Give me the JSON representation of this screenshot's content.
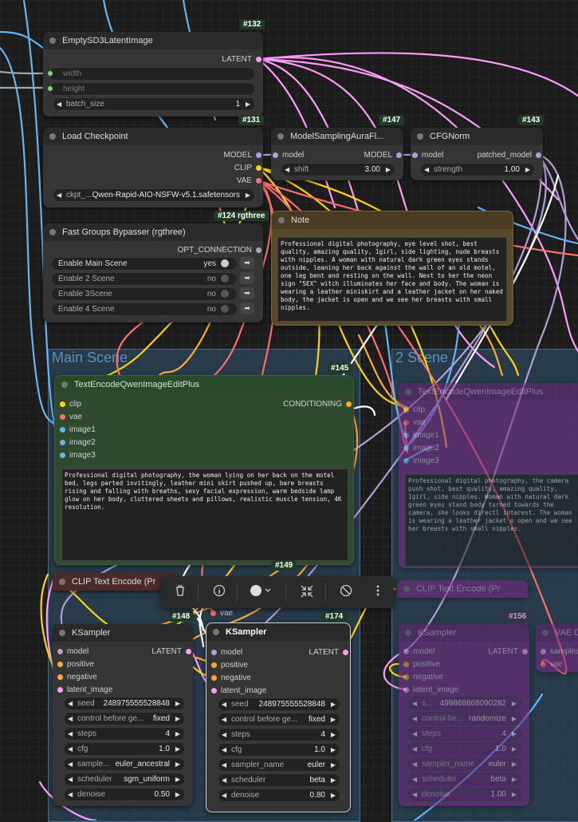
{
  "colors": {
    "latent": "#ff9cf9",
    "model": "#b39ddb",
    "clip": "#ffd500",
    "vae": "#ff6e6e",
    "image": "#64b5f6",
    "conditioning": "#ffa931",
    "white": "#ffffff"
  },
  "groups": {
    "main": "Main Scene",
    "scene2": "2 Scene"
  },
  "nodes": {
    "n132": {
      "badge": "#132",
      "title": "EmptySD3LatentImage",
      "out_latent": "LATENT",
      "w_width": "width",
      "w_height": "height",
      "w_batch_label": "batch_size",
      "w_batch_value": "1"
    },
    "n131": {
      "badge": "#131",
      "title": "Load Checkpoint",
      "out_model": "MODEL",
      "out_clip": "CLIP",
      "out_vae": "VAE",
      "w_ckpt_label": "ckpt_...",
      "w_ckpt_value": "Qwen-Rapid-AIO-NSFW-v5.1.safetensors"
    },
    "n147": {
      "badge": "#147",
      "title": "ModelSamplingAuraFl...",
      "in_model": "model",
      "out_model": "MODEL",
      "w_label": "shift",
      "w_value": "3.00"
    },
    "n143": {
      "badge": "#143",
      "title": "CFGNorm",
      "in_model": "model",
      "out_model": "patched_model",
      "w_label": "strength",
      "w_value": "1.00"
    },
    "n124": {
      "badge": "#124 rgthree",
      "title": "Fast Groups Bypasser (rgthree)",
      "out": "OPT_CONNECTION",
      "toggles": [
        {
          "label": "Enable Main Scene",
          "state": "yes"
        },
        {
          "label": "Enable 2 Scene",
          "state": "no"
        },
        {
          "label": "Enable 3Scene",
          "state": "no"
        },
        {
          "label": "Enable 4 Scene",
          "state": "no"
        }
      ]
    },
    "note": {
      "title": "Note",
      "text": "Professional digital photography, eye level shot, best quality, amazing quality, 1girl, side lighting, nude breasts with nipples. A woman with natural dark green eyes stands outside, leaning her back against the wall of an old motel, one leg bent and resting on the wall. Next to her the neon sign \"SEX\" witch illuminates her face and body. The woman is wearing a leather miniskirt and a leather jacket on her naked body, the jacket is open and we see her breasts with small nipples."
    },
    "n145": {
      "badge": "#145",
      "title": "TextEncodeQwenImageEditPlus",
      "inputs": [
        "clip",
        "vae",
        "image1",
        "image2",
        "image3"
      ],
      "out": "CONDITIONING",
      "text": "Professional digital photography, the woman lying on her back on the motel bed, legs parted invitingly, leather mini skirt pushed up, bare breasts rising and falling with breaths, sexy facial expression, warm bedside lamp glow on her body, cluttered sheets and pillows, realistic muscle tension, 4K resolution."
    },
    "s2enc": {
      "title": "TextEncodeQwenImageEditPlus",
      "inputs": [
        "clip",
        "vae",
        "image1",
        "image2",
        "image3"
      ],
      "text": "Professional digital photography, the camera push shot, best quality, amazing quality, 1girl, side nipples. Woman with natural dark green eyes stand body turned towards the camera, she looks directl interest. The woman is wearing a leather jacket o open and we see her breasts with small nipples."
    },
    "n149": {
      "badge": "#149",
      "title": "CLIP Text Encode (Pr",
      "vae": "vae"
    },
    "s2clip": {
      "title": "CLIP Text Encode (Pr"
    },
    "n148": {
      "badge": "#148",
      "title": "KSampler",
      "inputs": [
        "model",
        "positive",
        "negative",
        "latent_image"
      ],
      "out": "LATENT",
      "widgets": [
        {
          "label": "seed",
          "value": "248975555528848"
        },
        {
          "label": "control before ge...",
          "value": "fixed"
        },
        {
          "label": "steps",
          "value": "4"
        },
        {
          "label": "cfg",
          "value": "1.0"
        },
        {
          "label": "sample...",
          "value": "euler_ancestral"
        },
        {
          "label": "scheduler",
          "value": "sgm_uniform"
        },
        {
          "label": "denoise",
          "value": "0.50"
        }
      ]
    },
    "n174": {
      "badge": "#174",
      "title": "KSampler",
      "inputs": [
        "model",
        "positive",
        "negative",
        "latent_image"
      ],
      "out": "LATENT",
      "widgets": [
        {
          "label": "seed",
          "value": "248975555528848"
        },
        {
          "label": "control before ge...",
          "value": "fixed"
        },
        {
          "label": "steps",
          "value": "4"
        },
        {
          "label": "cfg",
          "value": "1.0"
        },
        {
          "label": "sampler_name",
          "value": "euler"
        },
        {
          "label": "scheduler",
          "value": "beta"
        },
        {
          "label": "denoise",
          "value": "0.80"
        }
      ]
    },
    "n156": {
      "badge": "#156",
      "title": "KSampler",
      "inputs": [
        "model",
        "positive",
        "negative",
        "latent_image"
      ],
      "out": "LATENT",
      "widgets": [
        {
          "label": "s...",
          "value": "499868868090282"
        },
        {
          "label": "control be...",
          "value": "randomize"
        },
        {
          "label": "steps",
          "value": "4"
        },
        {
          "label": "cfg",
          "value": "1.0"
        },
        {
          "label": "sampler_name",
          "value": "euler"
        },
        {
          "label": "scheduler",
          "value": "beta"
        },
        {
          "label": "denoise",
          "value": "1.00"
        }
      ]
    },
    "vae": {
      "title": "VAE D",
      "in_samples": "samples",
      "in_vae": "vae"
    }
  },
  "toolbar": {
    "items": [
      "trash-icon",
      "info-icon",
      "color-icon",
      "shrink-icon",
      "bypass-icon",
      "more-icon"
    ]
  }
}
